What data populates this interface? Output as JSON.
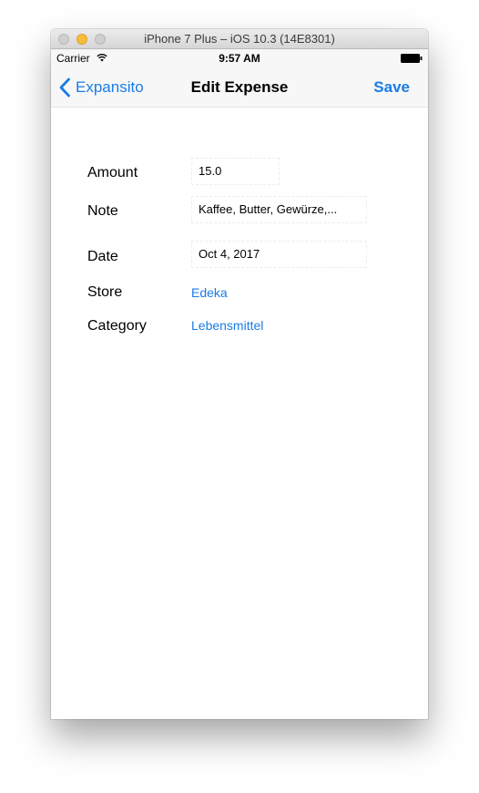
{
  "window": {
    "title": "iPhone 7 Plus – iOS 10.3 (14E8301)"
  },
  "status_bar": {
    "carrier": "Carrier",
    "time": "9:57 AM",
    "wifi_icon": "wifi-icon",
    "battery_icon": "battery-icon"
  },
  "nav": {
    "back_label": "Expansito",
    "back_icon": "chevron-left-icon",
    "title": "Edit Expense",
    "save_label": "Save"
  },
  "form": {
    "amount": {
      "label": "Amount",
      "value": "15.0"
    },
    "note": {
      "label": "Note",
      "value": "Kaffee, Butter, Gewürze,..."
    },
    "date": {
      "label": "Date",
      "value": "Oct 4, 2017"
    },
    "store": {
      "label": "Store",
      "value": "Edeka"
    },
    "category": {
      "label": "Category",
      "value": "Lebensmittel"
    }
  },
  "colors": {
    "accent": "#1a7ce6",
    "nav_background": "#f7f7f7",
    "yellow_traffic_light": "#f6bd3b"
  }
}
